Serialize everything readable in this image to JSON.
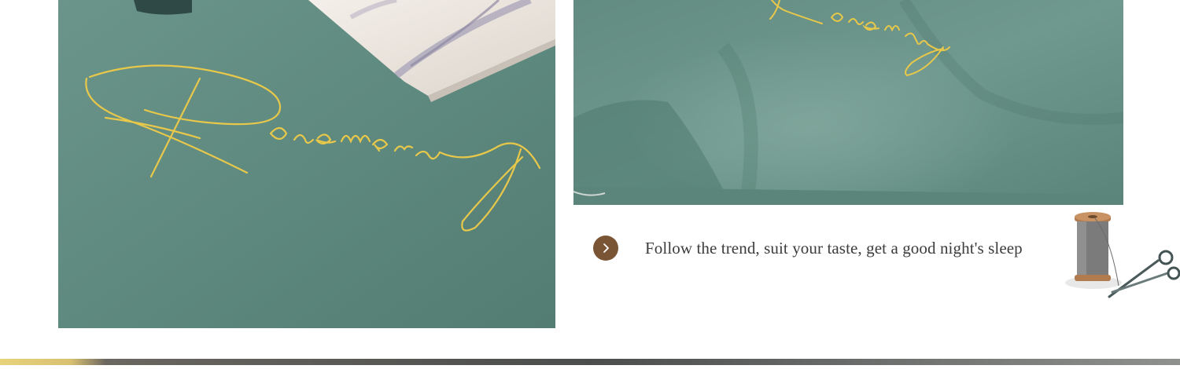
{
  "photos": {
    "left": {
      "embroidery": "Rosemary"
    },
    "right": {
      "embroidery": "Rosemary"
    }
  },
  "caption": {
    "text": "Follow the trend, suit your taste, get a good night's sleep",
    "arrow_icon": "chevron-right-icon"
  },
  "colors": {
    "fabric_green": "#5f8a80",
    "gold_embroidery": "#e8c84a",
    "arrow_brown": "#7a5535",
    "caption_text": "#3c3c3c"
  }
}
